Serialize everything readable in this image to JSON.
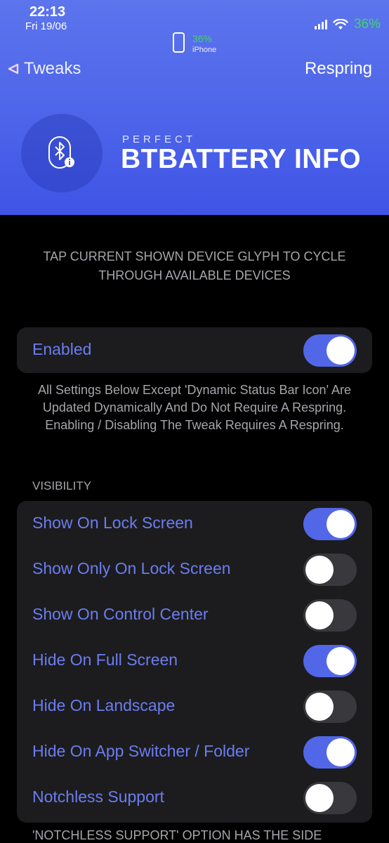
{
  "status_bar": {
    "time": "22:13",
    "date": "Fri 19/06",
    "battery": "36%"
  },
  "device": {
    "battery": "36%",
    "name": "iPhone"
  },
  "nav": {
    "back_label": "Tweaks",
    "respring_label": "Respring"
  },
  "header": {
    "subtitle": "PERFECT",
    "title": "BTBATTERY INFO"
  },
  "intro_note": "TAP CURRENT SHOWN DEVICE GLYPH TO CYCLE THROUGH AVAILABLE DEVICES",
  "main_toggle": {
    "label": "Enabled",
    "on": true
  },
  "main_footer": "All Settings Below Except 'Dynamic Status Bar Icon' Are Updated Dynamically And Do Not Require A Respring. Enabling / Disabling The Tweak Requires A Respring.",
  "visibility": {
    "header": "VISIBILITY",
    "items": [
      {
        "label": "Show On Lock Screen",
        "on": true
      },
      {
        "label": "Show Only On Lock Screen",
        "on": false
      },
      {
        "label": "Show On Control Center",
        "on": false
      },
      {
        "label": "Hide On Full Screen",
        "on": true
      },
      {
        "label": "Hide On Landscape",
        "on": false
      },
      {
        "label": "Hide On App Switcher / Folder",
        "on": true
      },
      {
        "label": "Notchless Support",
        "on": false
      }
    ],
    "footer": "'NOTCHLESS SUPPORT' OPTION HAS THE SIDE"
  },
  "colors": {
    "accent": "#5266e8",
    "label": "#6b7df0",
    "battery_green": "#3fd46a"
  }
}
